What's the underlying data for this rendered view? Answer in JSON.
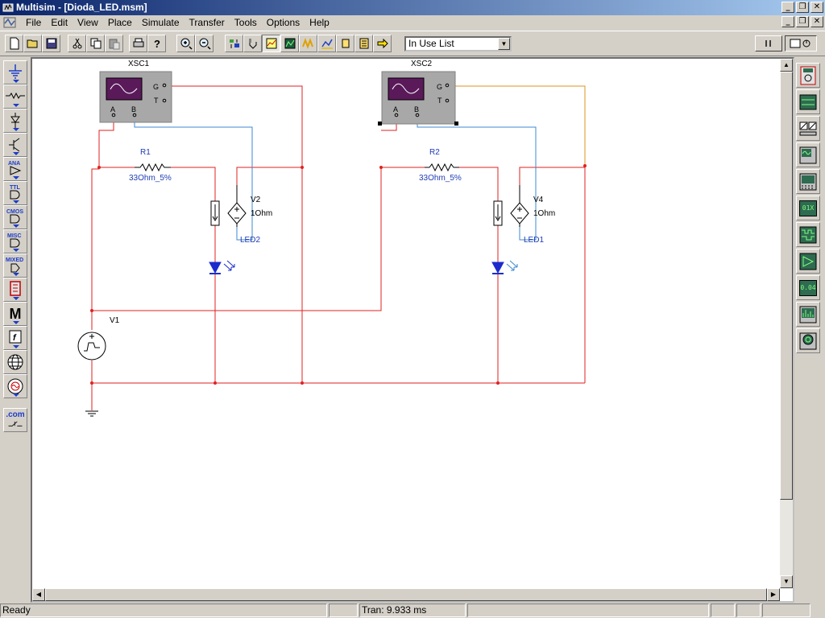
{
  "window": {
    "title": "Multisim - [Dioda_LED.msm]",
    "caption_minimize": "_",
    "caption_restore": "❐",
    "caption_close": "✕"
  },
  "menu": {
    "items": [
      "File",
      "Edit",
      "View",
      "Place",
      "Simulate",
      "Transfer",
      "Tools",
      "Options",
      "Help"
    ]
  },
  "toolbar": {
    "in_use_list": "In Use List"
  },
  "schematic": {
    "xsc1": {
      "label": "XSC1",
      "pin_a": "A",
      "pin_b": "B",
      "pin_g": "G",
      "pin_t": "T"
    },
    "xsc2": {
      "label": "XSC2",
      "pin_a": "A",
      "pin_b": "B",
      "pin_g": "G",
      "pin_t": "T"
    },
    "r1": {
      "name": "R1",
      "value": "33Ohm_5%"
    },
    "r2": {
      "name": "R2",
      "value": "33Ohm_5%"
    },
    "v2": {
      "name": "V2",
      "value": "1Ohm"
    },
    "v4": {
      "name": "V4",
      "value": "1Ohm"
    },
    "led2": {
      "name": "LED2"
    },
    "led1": {
      "name": "LED1"
    },
    "v1": {
      "name": "V1"
    },
    "colors": {
      "wire": "#e02020",
      "probe_b": "#3c8ad0",
      "probe_g": "#e09020",
      "led": "#1c2ccc",
      "label": "#1e3cb4"
    }
  },
  "left_palette": {
    "ana": "ANA",
    "ttl": "TTL",
    "cmos": "CMOS",
    "misc": "MISC",
    "mixed": "MIXED",
    "m": "M",
    "f": "f",
    "com": ".com"
  },
  "right_palette": {
    "ammeter": "01X",
    "counter": "0.04"
  },
  "status": {
    "ready": "Ready",
    "tran": "Tran: 9.933 ms"
  }
}
